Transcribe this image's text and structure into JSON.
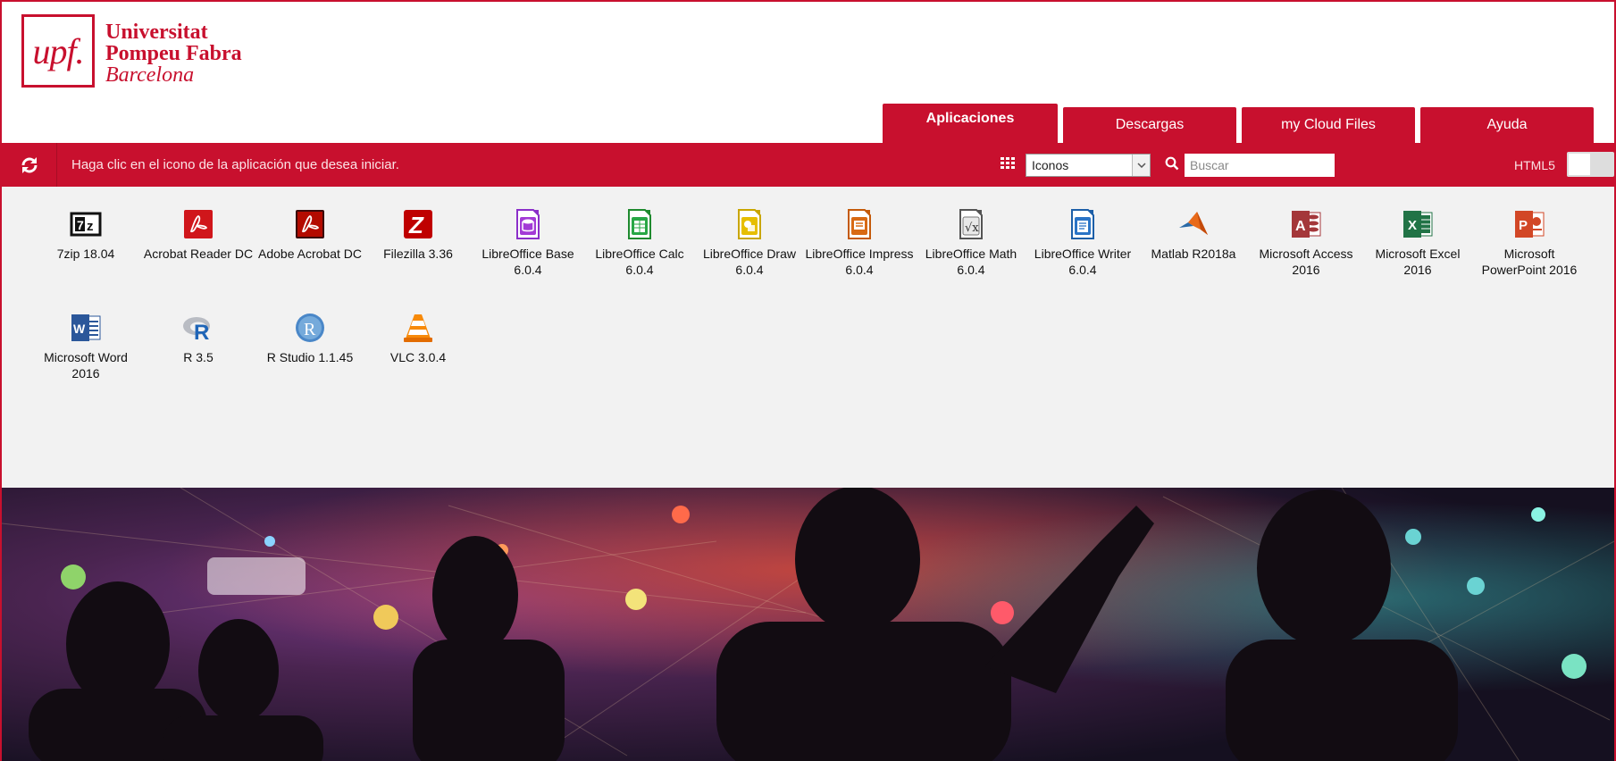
{
  "logo": {
    "mark": "upf.",
    "line1": "Universitat",
    "line2": "Pompeu Fabra",
    "line3": "Barcelona"
  },
  "tabs": [
    {
      "label": "Aplicaciones",
      "active": true
    },
    {
      "label": "Descargas",
      "active": false
    },
    {
      "label": "my Cloud Files",
      "active": false
    },
    {
      "label": "Ayuda",
      "active": false
    }
  ],
  "toolbar": {
    "hint": "Haga clic en el icono de la aplicación que desea iniciar.",
    "view_selected": "Iconos",
    "search_placeholder": "Buscar",
    "html5_label": "HTML5"
  },
  "apps": [
    {
      "label": "7zip 18.04",
      "icon": "7zip-icon"
    },
    {
      "label": "Acrobat Reader DC",
      "icon": "acrobat-reader-icon"
    },
    {
      "label": "Adobe Acrobat DC",
      "icon": "adobe-acrobat-icon"
    },
    {
      "label": "Filezilla 3.36",
      "icon": "filezilla-icon"
    },
    {
      "label": "LibreOffice Base 6.0.4",
      "icon": "libreoffice-base-icon"
    },
    {
      "label": "LibreOffice Calc 6.0.4",
      "icon": "libreoffice-calc-icon"
    },
    {
      "label": "LibreOffice Draw 6.0.4",
      "icon": "libreoffice-draw-icon"
    },
    {
      "label": "LibreOffice Impress 6.0.4",
      "icon": "libreoffice-impress-icon"
    },
    {
      "label": "LibreOffice Math 6.0.4",
      "icon": "libreoffice-math-icon"
    },
    {
      "label": "LibreOffice Writer 6.0.4",
      "icon": "libreoffice-writer-icon"
    },
    {
      "label": "Matlab R2018a",
      "icon": "matlab-icon"
    },
    {
      "label": "Microsoft Access 2016",
      "icon": "ms-access-icon"
    },
    {
      "label": "Microsoft Excel 2016",
      "icon": "ms-excel-icon"
    },
    {
      "label": "Microsoft PowerPoint 2016",
      "icon": "ms-powerpoint-icon"
    },
    {
      "label": "Microsoft Word 2016",
      "icon": "ms-word-icon"
    },
    {
      "label": "R 3.5",
      "icon": "r-icon"
    },
    {
      "label": "R Studio 1.1.45",
      "icon": "rstudio-icon"
    },
    {
      "label": "VLC 3.0.4",
      "icon": "vlc-icon"
    }
  ],
  "colors": {
    "brand": "#c8102e",
    "background": "#f2f2f2"
  }
}
